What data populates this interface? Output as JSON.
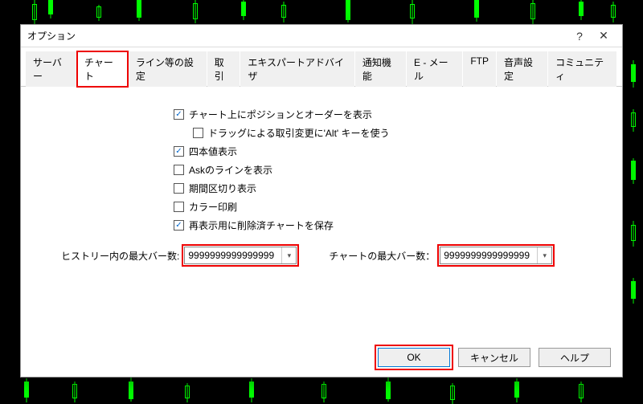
{
  "window": {
    "title": "オプション"
  },
  "tabs": {
    "server": "サーバー",
    "chart": "チャート",
    "lines": "ライン等の設定",
    "trade": "取引",
    "ea": "エキスパートアドバイザ",
    "notify": "通知機能",
    "email": "E - メール",
    "ftp": "FTP",
    "audio": "音声設定",
    "community": "コミュニティ"
  },
  "options": {
    "show_pos": "チャート上にポジションとオーダーを表示",
    "drag_alt": "ドラッグによる取引変更に'Alt' キーを使う",
    "ohlc": "四本値表示",
    "ask_line": "Askのラインを表示",
    "period_sep": "期間区切り表示",
    "color_print": "カラー印刷",
    "save_deleted": "再表示用に削除済チャートを保存"
  },
  "checked": {
    "show_pos": true,
    "drag_alt": false,
    "ohlc": true,
    "ask_line": false,
    "period_sep": false,
    "color_print": false,
    "save_deleted": true
  },
  "fields": {
    "history_label": "ヒストリー内の最大バー数:",
    "history_value": "9999999999999999",
    "chart_label": "チャートの最大バー数：",
    "chart_value": "9999999999999999"
  },
  "buttons": {
    "ok": "OK",
    "cancel": "キャンセル",
    "help": "ヘルプ"
  }
}
